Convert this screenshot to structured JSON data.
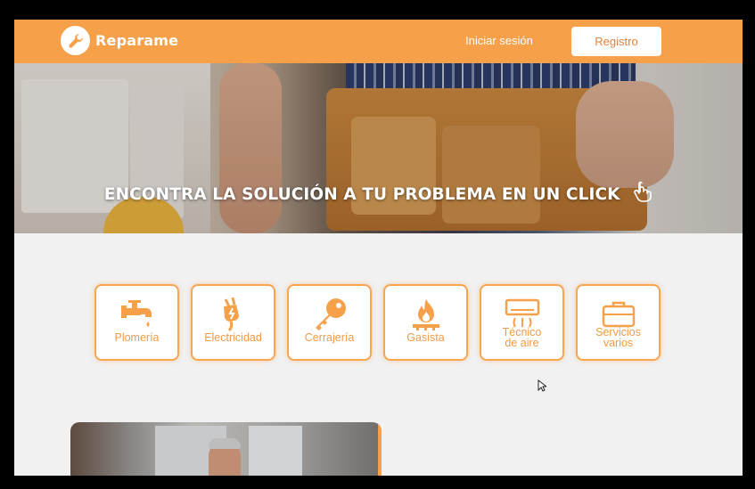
{
  "header": {
    "brand": "Reparame",
    "login_label": "Iniciar sesión",
    "register_label": "Registro"
  },
  "hero": {
    "title": "ENCONTRA LA SOLUCIÓN A TU PROBLEMA EN UN CLICK"
  },
  "categories": [
    {
      "lines": [
        "Plomería"
      ],
      "icon": "faucet-icon"
    },
    {
      "lines": [
        "Electricidad"
      ],
      "icon": "plug-icon"
    },
    {
      "lines": [
        "Cerrajería"
      ],
      "icon": "key-icon"
    },
    {
      "lines": [
        "Gasista"
      ],
      "icon": "flame-icon"
    },
    {
      "lines": [
        "Técnico",
        "de aire"
      ],
      "icon": "air-conditioner-icon"
    },
    {
      "lines": [
        "Servicios",
        "varios"
      ],
      "icon": "briefcase-icon"
    }
  ],
  "colors": {
    "accent": "#f7a04a",
    "accent_text": "#f19a45",
    "background": "#f1f1f1"
  }
}
